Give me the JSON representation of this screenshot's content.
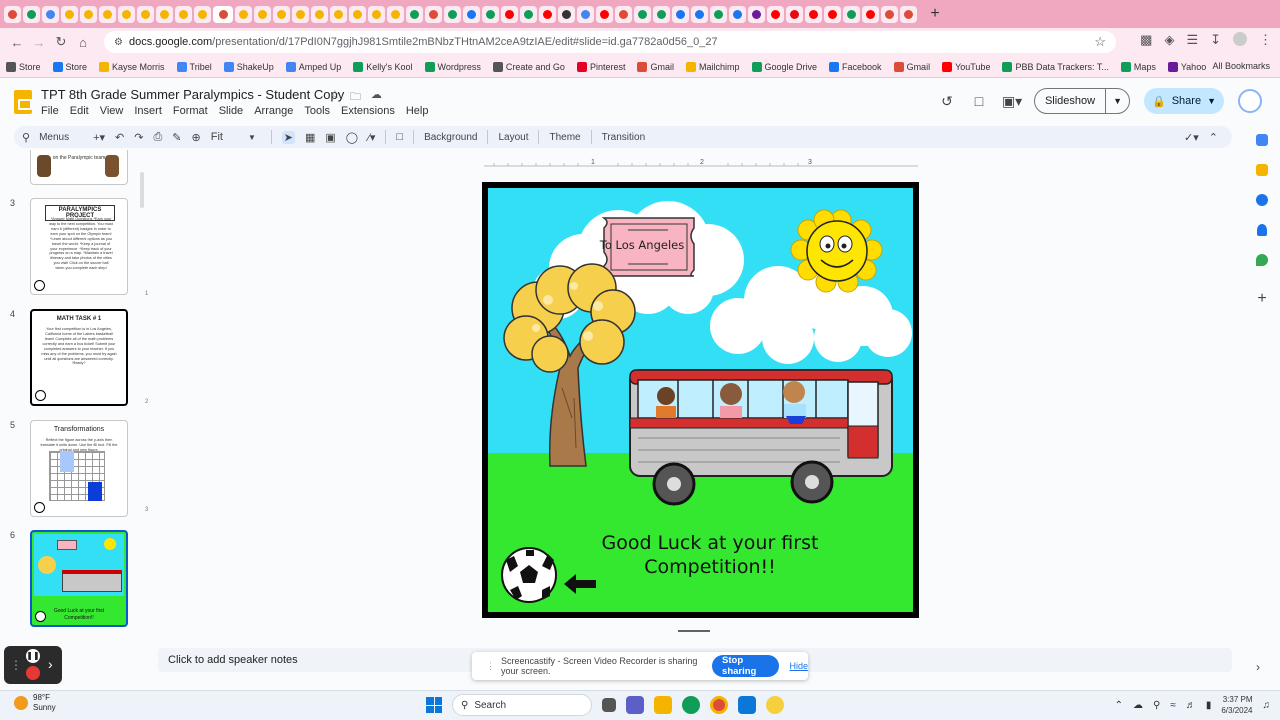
{
  "browser": {
    "url_host": "docs.google.com",
    "url_path": "/presentation/d/17PdI0N7ggjhJ981Smtile2mBNbzTHtnAM2ceA9tzIAE/edit#slide=id.ga7782a0d56_0_27",
    "tab_colors": [
      "#dd4b39",
      "#0f9d58",
      "#4285f4",
      "#f4b400",
      "#f4b400",
      "#f4b400",
      "#f4b400",
      "#f4b400",
      "#f4b400",
      "#f4b400",
      "#f4b400",
      "#dd4b39",
      "#f4b400",
      "#f4b400",
      "#f4b400",
      "#f4b400",
      "#f4b400",
      "#f4b400",
      "#f4b400",
      "#f4b400",
      "#f4b400",
      "#0f9d58",
      "#dd4b39",
      "#0f9d58",
      "#1877f2",
      "#0f9d58",
      "#ff0000",
      "#0f9d58",
      "#ff0000",
      "#333333",
      "#4285f4",
      "#ff0000",
      "#dd4b39",
      "#0f9d58",
      "#0f9d58",
      "#1877f2",
      "#1877f2",
      "#0f9d58",
      "#1877f2",
      "#6a1b9a",
      "#ff0000",
      "#e50914",
      "#ff0000",
      "#ff0000",
      "#0f9d58",
      "#ff0000",
      "#dd4b39",
      "#dd4b39"
    ]
  },
  "bookmarks": [
    {
      "label": "Store",
      "color": "#555555"
    },
    {
      "label": "Store",
      "color": "#1877f2"
    },
    {
      "label": "Kayse Morris",
      "color": "#f4b400"
    },
    {
      "label": "Tribel",
      "color": "#4285f4"
    },
    {
      "label": "ShakeUp",
      "color": "#4285f4"
    },
    {
      "label": "Amped Up",
      "color": "#4285f4"
    },
    {
      "label": "Kelly's Kool",
      "color": "#0f9d58"
    },
    {
      "label": "Wordpress",
      "color": "#0f9d58"
    },
    {
      "label": "Create and Go",
      "color": "#555555"
    },
    {
      "label": "Pinterest",
      "color": "#e60023"
    },
    {
      "label": "Gmail",
      "color": "#dd4b39"
    },
    {
      "label": "Mailchimp",
      "color": "#f4b400"
    },
    {
      "label": "Google Drive",
      "color": "#0f9d58"
    },
    {
      "label": "Facebook",
      "color": "#1877f2"
    },
    {
      "label": "Gmail",
      "color": "#dd4b39"
    },
    {
      "label": "YouTube",
      "color": "#ff0000"
    },
    {
      "label": "PBB Data Trackers: T...",
      "color": "#0f9d58"
    },
    {
      "label": "Maps",
      "color": "#0f9d58"
    },
    {
      "label": "Yahoo",
      "color": "#6a1b9a"
    }
  ],
  "all_bookmarks": "All Bookmarks",
  "doc": {
    "title": "TPT 8th Grade Summer Paralympics - Student Copy",
    "menus": [
      "File",
      "Edit",
      "View",
      "Insert",
      "Format",
      "Slide",
      "Arrange",
      "Tools",
      "Extensions",
      "Help"
    ],
    "slideshow_label": "Slideshow",
    "share_label": "Share"
  },
  "toolbar": {
    "menus_label": "Menus",
    "zoom": "Fit",
    "background": "Background",
    "layout": "Layout",
    "theme": "Theme",
    "transition": "Transition"
  },
  "ruler": {
    "h_ticks": [
      "1",
      "2",
      "3"
    ],
    "v_ticks": [
      "1",
      "2",
      "3"
    ]
  },
  "filmstrip": [
    {
      "num": "",
      "title": "",
      "body": "on the Paralympic team"
    },
    {
      "num": "3",
      "title": "PARALYMPICS PROJECT",
      "body": "*Answer Math Questions *Earn your way to the next competition. You must earn 6 (different) badges in order to earn your spot on the Olympic team! *Learn about different options as you travel the world. *Keep a journal of your experience. *Keep track of your progress on a map. *Maintain a travel itinerary and take photos of the cities you visit! Click on the soccer ball when you complete each step!"
    },
    {
      "num": "4",
      "title": "MATH TASK # 1",
      "body": "Your first competition is in Los Angeles, California home of the Lakers basketball team! Complete all of the math problems correctly and earn a bus ticket! Submit your completed answers to your teacher. If you miss any of the problems, you must try again until all questions are answered correctly. Ready?"
    },
    {
      "num": "5",
      "title": "Transformations",
      "body": "Reflect the figure across the y-axis then translate it units down. Use the fill tool. Fill the original and new figure."
    },
    {
      "num": "6",
      "title": "",
      "body": "Good Luck at your first Competition!!"
    }
  ],
  "slide": {
    "ticket_text": "To Los Angeles",
    "message_line1": "Good Luck at your first",
    "message_line2": "Competition!!"
  },
  "notes_placeholder": "Click to add speaker notes",
  "screencastify": {
    "message": "Screencastify - Screen Video Recorder is sharing your screen.",
    "stop_label": "Stop sharing",
    "hide_label": "Hide"
  },
  "taskbar": {
    "temperature": "98°F",
    "condition": "Sunny",
    "search_placeholder": "Search",
    "time": "3:37 PM",
    "date": "6/3/2024"
  }
}
